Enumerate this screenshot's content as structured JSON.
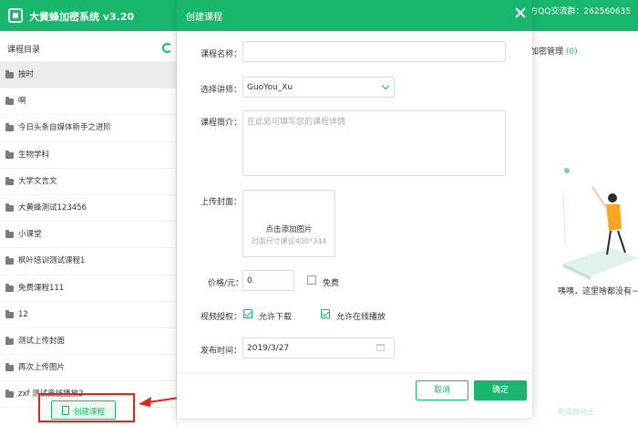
{
  "app": {
    "title": "大黄蜂加密系统 v3.20",
    "qq_group": "方QQ交流群：262560635"
  },
  "sidebar": {
    "title": "课程目录",
    "items": [
      {
        "label": "按时",
        "active": true
      },
      {
        "label": "啊"
      },
      {
        "label": "今日头条自媒体新手之进阶"
      },
      {
        "label": "生物学科"
      },
      {
        "label": "大学文言文"
      },
      {
        "label": "大黄蜂测试123456"
      },
      {
        "label": "小课堂"
      },
      {
        "label": "枫叶培训测试课程1"
      },
      {
        "label": "免费课程111"
      },
      {
        "label": "12"
      },
      {
        "label": "测试上传封面"
      },
      {
        "label": "再次上传图片"
      },
      {
        "label": "zxf 测试离线播放2"
      }
    ],
    "create_button": "创建课程"
  },
  "right_panel": {
    "tab_label": "加密管理",
    "tab_count": "(0)",
    "empty_text": "咦咦，这里啥都没有~试",
    "auto_text": "免成自动上"
  },
  "modal": {
    "title": "创建课程",
    "name_label": "课程名称：",
    "name_value": "",
    "teacher_label": "选择讲师：",
    "teacher_value": "GuoYou_Xu",
    "desc_label": "课程简介：",
    "desc_placeholder": "在此处可填写您的课程详情",
    "cover_label": "上传封面：",
    "cover_add": "点击添加图片",
    "cover_hint": "封面尺寸建议400*344",
    "price_label": "价格/元：",
    "price_value": "0",
    "free_label": "免费",
    "auth_label": "视频授权：",
    "allow_download": "允许下载",
    "allow_online": "允许在线播放",
    "date_label": "发布时间：",
    "date_value": "2019/3/27",
    "cancel_label": "取消",
    "confirm_label": "确定"
  },
  "colors": {
    "brand": "#19b76e",
    "highlight": "#e2231a"
  }
}
